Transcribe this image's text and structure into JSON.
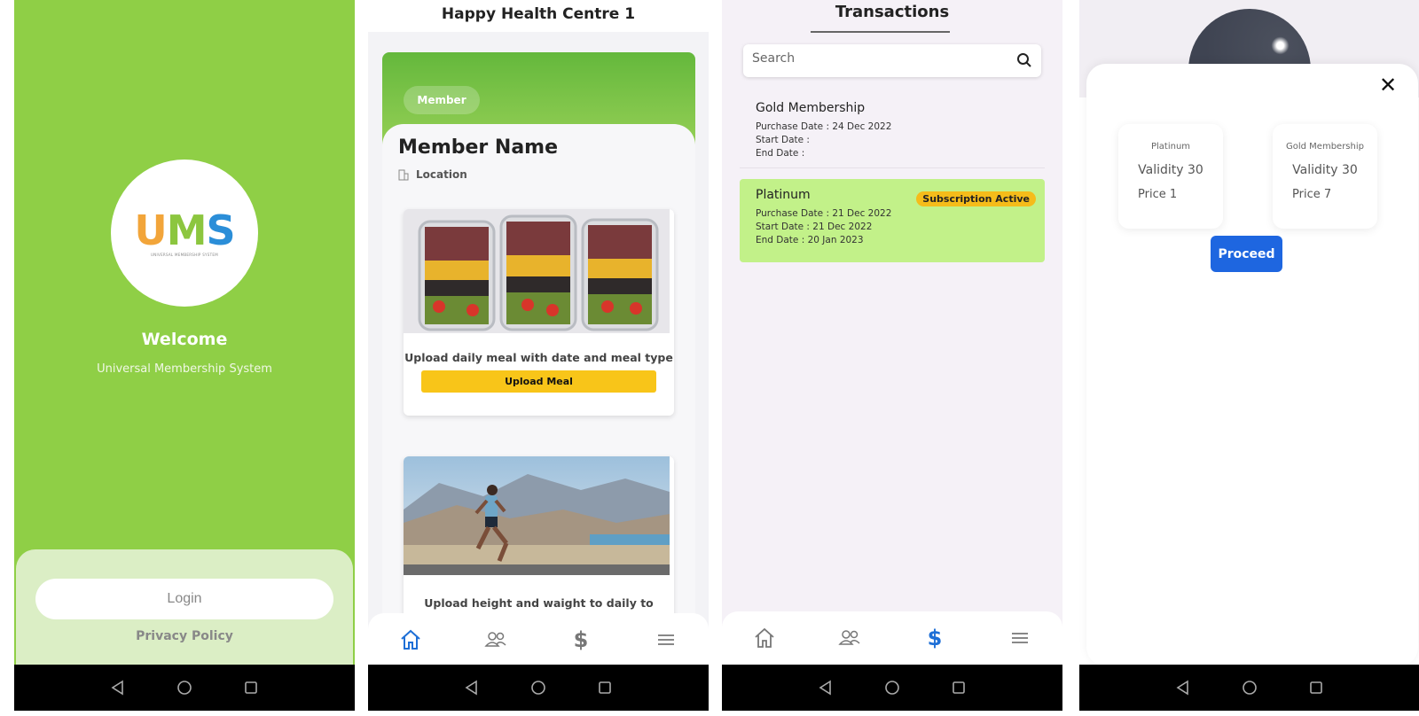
{
  "screen1": {
    "logo_text": "UMS",
    "logo_subtitle": "UNIVERSAL MEMBERSHIP SYSTEM",
    "welcome": "Welcome",
    "subtitle": "Universal Membership System",
    "login_label": "Login",
    "privacy_label": "Privacy Policy",
    "bg_color": "#8fcf46"
  },
  "screen2": {
    "title": "Happy Health Centre 1",
    "member_chip": "Member",
    "member_name": "Member Name",
    "location": "Location",
    "meal_card": {
      "caption": "Upload daily meal with date and meal type",
      "button": "Upload Meal"
    },
    "run_card": {
      "caption": "Upload height and waight to daily to"
    },
    "active_tab": "home"
  },
  "screen3": {
    "title": "Transactions",
    "search_placeholder": "Search",
    "transactions": [
      {
        "title": "Gold Membership",
        "purchase": "Purchase Date : 24 Dec 2022",
        "start": "Start Date :",
        "end": "End Date :"
      },
      {
        "title": "Platinum",
        "badge": "Subscription Active",
        "purchase": "Purchase Date : 21 Dec 2022",
        "start": "Start Date : 21 Dec 2022",
        "end": "End Date : 20 Jan 2023"
      }
    ],
    "active_tab": "transactions"
  },
  "screen4": {
    "close": "✕",
    "plans": [
      {
        "name": "Platinum",
        "validity": "Validity 30",
        "price": "Price 1"
      },
      {
        "name": "Gold Membership",
        "validity": "Validity 30",
        "price": "Price 7"
      }
    ],
    "proceed": "Proceed"
  },
  "tabs": {
    "dollar_symbol": "$"
  },
  "colors": {
    "accent_blue": "#1e6fd6",
    "yellow": "#f8c519",
    "active_row": "#c2f189",
    "green": "#8fcf46"
  }
}
